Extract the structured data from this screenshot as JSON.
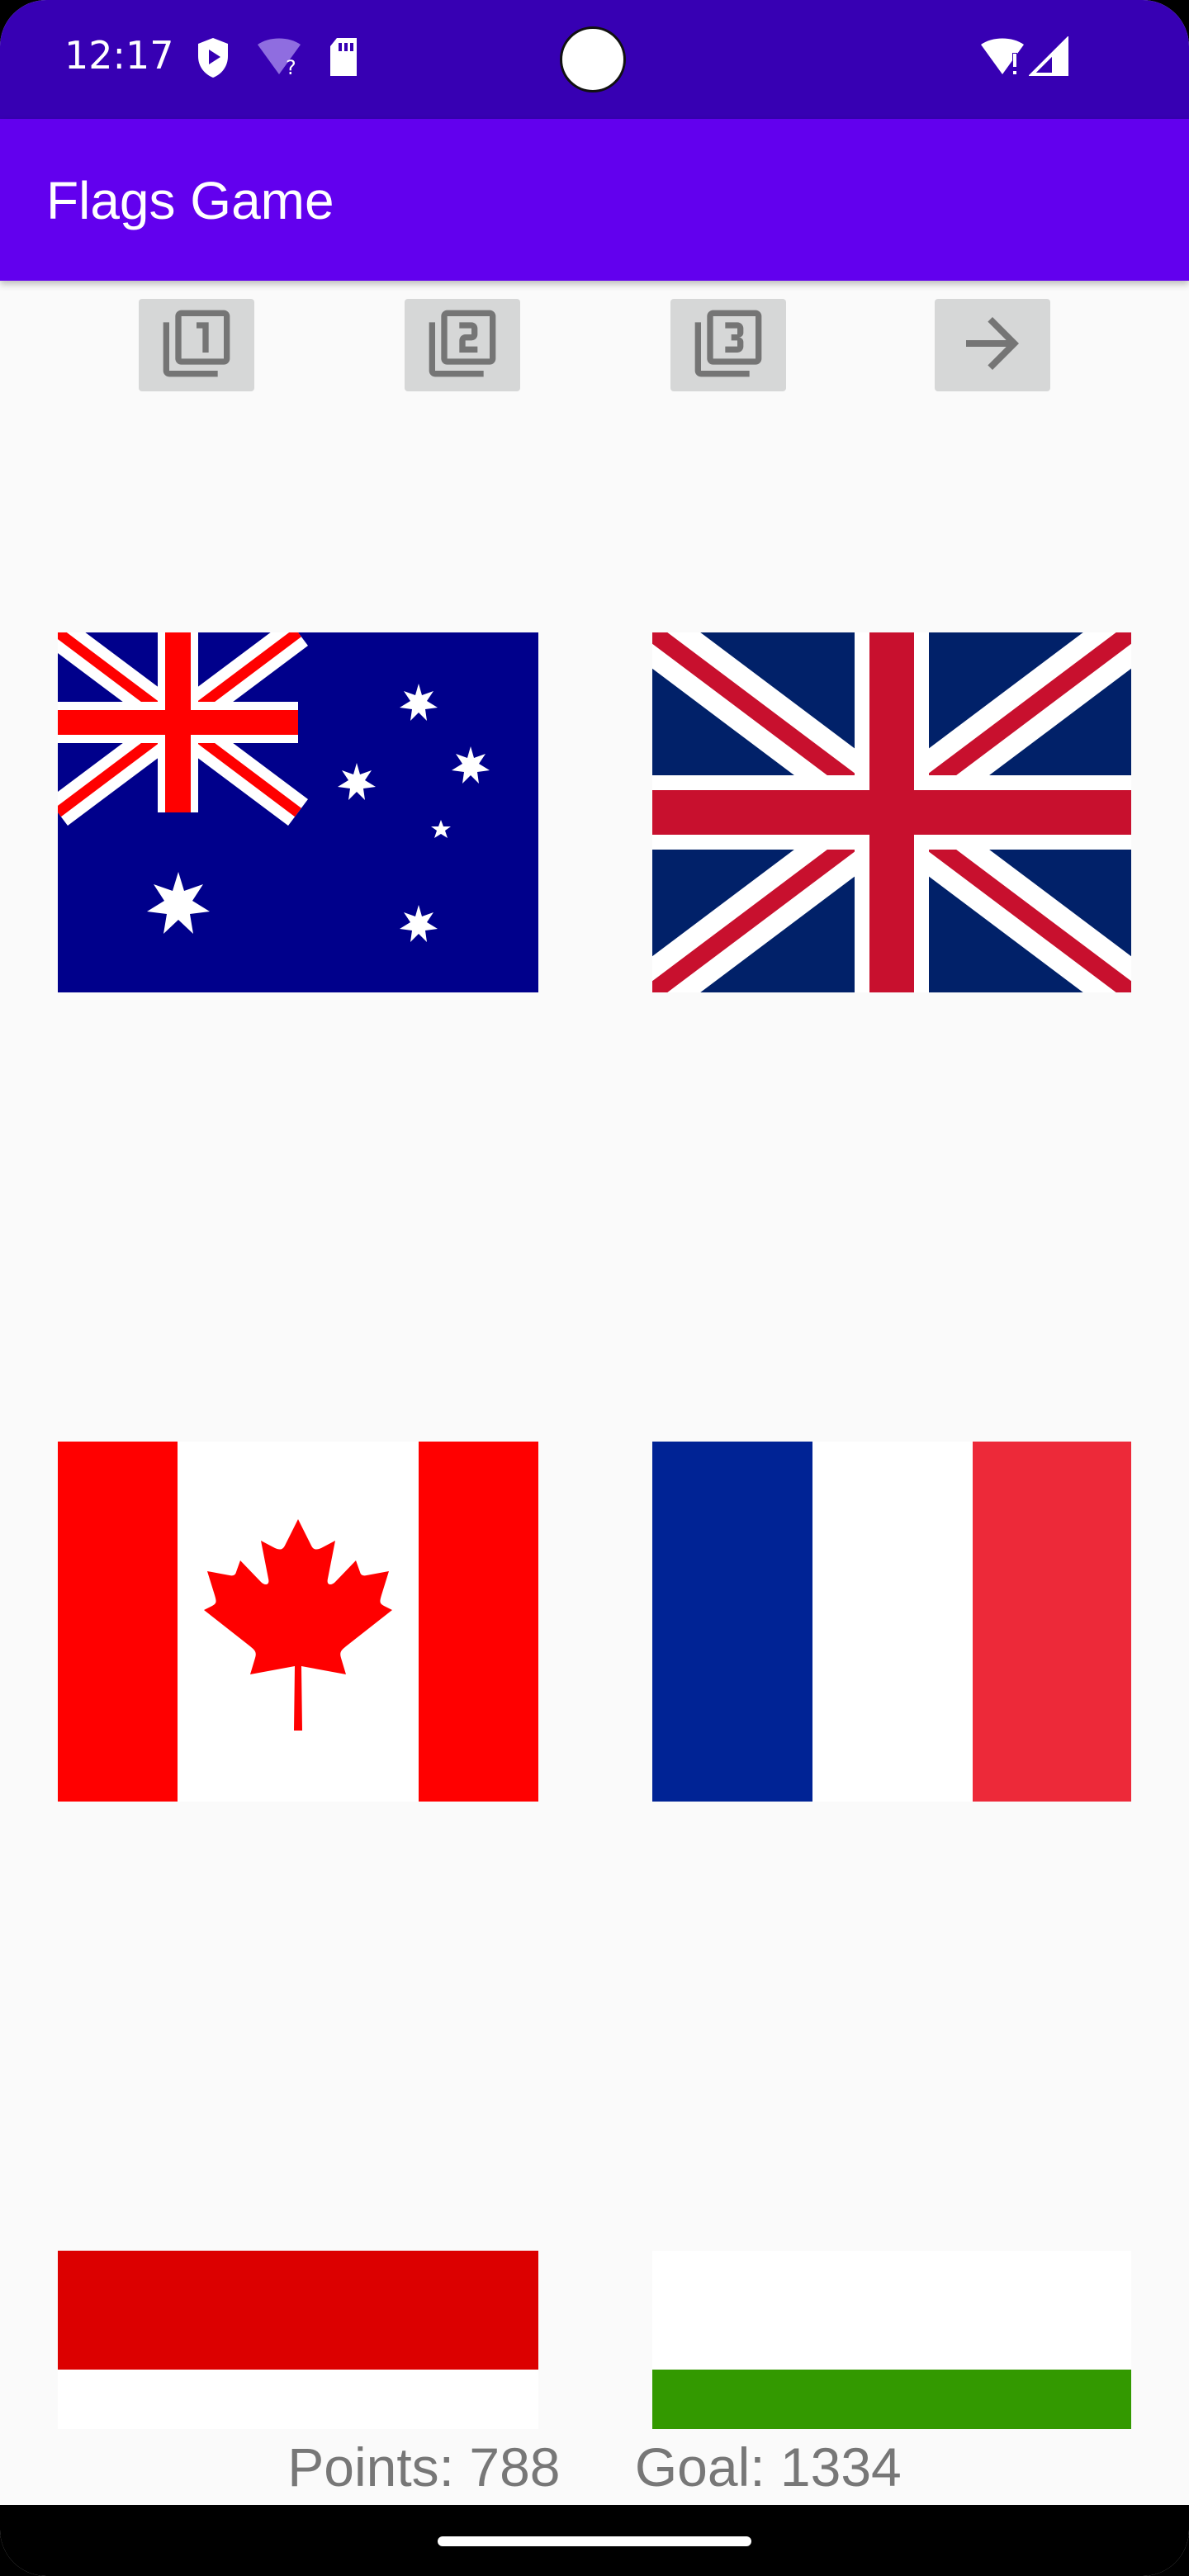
{
  "status_bar": {
    "time": "12:17",
    "icons": [
      "play-protect-icon",
      "wifi-question-icon",
      "sd-card-icon",
      "wifi-alert-icon",
      "signal-icon"
    ]
  },
  "app_bar": {
    "title": "Flags Game"
  },
  "toolbar": {
    "buttons": [
      "filter-1-icon",
      "filter-2-icon",
      "filter-3-icon",
      "arrow-right-icon"
    ]
  },
  "flags": [
    {
      "name": "australia-flag"
    },
    {
      "name": "united-kingdom-flag"
    },
    {
      "name": "canada-flag"
    },
    {
      "name": "france-flag"
    },
    {
      "name": "red-white-flag"
    },
    {
      "name": "white-green-flag"
    }
  ],
  "footer": {
    "points": "Points: 788",
    "goal": "Goal: 1334"
  },
  "colors": {
    "status_bar": "#3700b3",
    "app_bar": "#6200ee",
    "background": "#fafafa",
    "button_bg": "#d6d7d7",
    "icon_gray": "#757575"
  }
}
